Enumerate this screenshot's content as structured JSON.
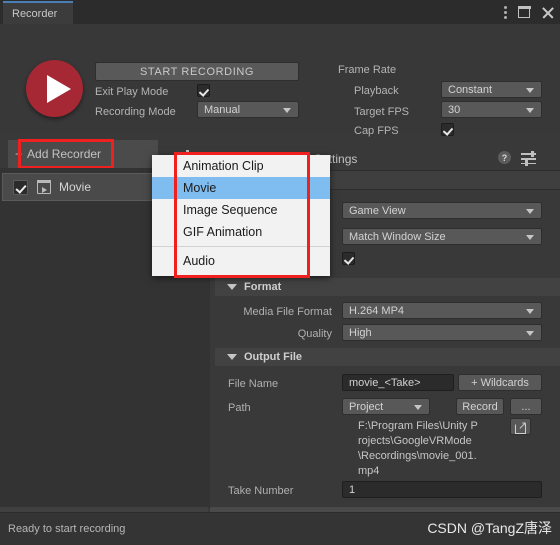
{
  "window": {
    "tab_label": "Recorder",
    "icons": {
      "menu": "kebab-menu-icon",
      "maximize": "maximize-icon",
      "close": "close-icon"
    }
  },
  "top": {
    "record_button_icon": "play-icon",
    "start_recording_label": "START RECORDING",
    "exit_play_mode_label": "Exit Play Mode",
    "exit_play_mode_checked": true,
    "recording_mode_label": "Recording Mode",
    "recording_mode_value": "Manual",
    "frame_rate_title": "Frame Rate",
    "playback_label": "Playback",
    "playback_value": "Constant",
    "target_fps_label": "Target FPS",
    "target_fps_value": "30",
    "cap_fps_label": "Cap FPS",
    "cap_fps_checked": true
  },
  "recorder_list": {
    "add_recorder_label": "Add Recorder",
    "add_recorder_plus": "+",
    "items": [
      {
        "label": "Movie",
        "checked": true,
        "icon": "movie-clip-icon"
      }
    ]
  },
  "add_recorder_menu": {
    "items": [
      {
        "label": "Animation Clip",
        "selected": false
      },
      {
        "label": "Movie",
        "selected": true
      },
      {
        "label": "Image Sequence",
        "selected": false
      },
      {
        "label": "GIF Animation",
        "selected": false
      },
      {
        "label": "Audio",
        "selected": false,
        "separator_before": true
      }
    ]
  },
  "settings": {
    "title": "Movie Recorder Settings",
    "help_icon_label": "?",
    "capture_source_value": "Game View",
    "resolution_value": "Match Window Size",
    "flip_vertical_checked": true,
    "format_section": {
      "title": "Format",
      "media_file_format_label": "Media File Format",
      "media_file_format_value": "H.264 MP4",
      "quality_label": "Quality",
      "quality_value": "High"
    },
    "output_section": {
      "title": "Output File",
      "file_name_label": "File Name",
      "file_name_value": "movie_<Take>",
      "wildcards_label": "+ Wildcards",
      "path_label": "Path",
      "path_value": "Project",
      "record_button_label": "Record",
      "browse_button_label": "...",
      "resolved_path": "F:\\Program Files\\Unity Projects\\GoogleVRMode\\Recordings\\movie_001.mp4",
      "take_number_label": "Take Number",
      "take_number_value": "1"
    }
  },
  "status": {
    "message": "Ready to start recording",
    "watermark": "CSDN @TangZ唐泽"
  },
  "colors": {
    "accent_tab": "#4a7fb5",
    "record_red": "#a52834",
    "highlight_red": "#ef2020",
    "menu_selection_blue": "#7fbdf0",
    "panel_bg": "#393939"
  }
}
